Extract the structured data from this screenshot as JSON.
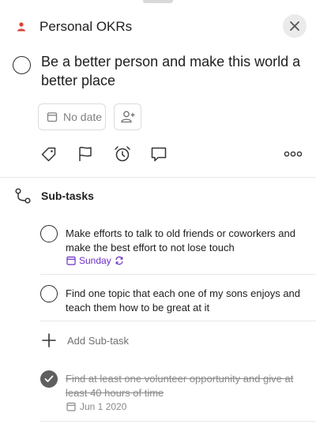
{
  "header": {
    "project_icon": "person-icon",
    "project_name": "Personal OKRs",
    "close_icon": "close-icon"
  },
  "task": {
    "title": "Be a better person and make this world a better place",
    "date_label": "No date",
    "assign_icon": "add-person-icon"
  },
  "actions": [
    "label-icon",
    "flag-icon",
    "alarm-icon",
    "comment-icon",
    "more-icon"
  ],
  "subtasks": {
    "heading": "Sub-tasks",
    "items": [
      {
        "text": "Make efforts to talk to old friends or coworkers and make the best effort to not lose touch",
        "due": "Sunday",
        "recurring": true,
        "completed": false
      },
      {
        "text": "Find one topic that each one of my sons enjoys and teach them how to be great at it",
        "completed": false
      }
    ],
    "add_label": "Add Sub-task",
    "completed_items": [
      {
        "text": "Find at least one volunteer opportunity and give at least 40 hours of time",
        "due": "Jun 1 2020",
        "completed": true
      }
    ]
  },
  "colors": {
    "accent_red": "#db4035",
    "date_purple": "#692fc2",
    "text_primary": "#202020",
    "text_muted": "#808080"
  }
}
